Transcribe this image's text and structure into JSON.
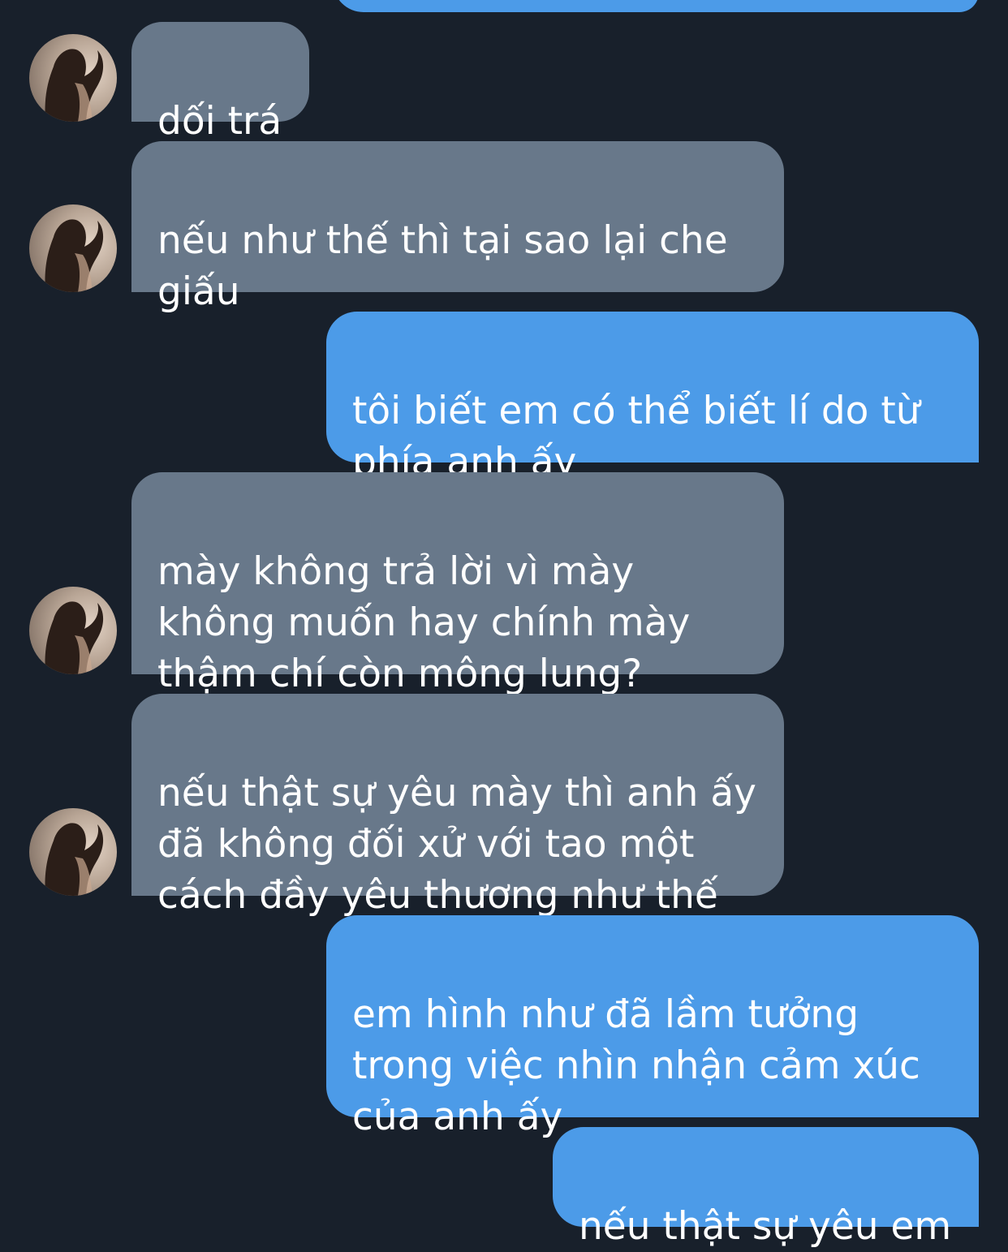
{
  "conversation": {
    "messages": [
      {
        "sender": "me",
        "text": ""
      },
      {
        "sender": "them",
        "text": "dối trá"
      },
      {
        "sender": "them",
        "text": "nếu như thế thì tại sao lại che\ngiấu"
      },
      {
        "sender": "me",
        "text": "tôi biết em có thể biết lí do từ\nphía anh ấy"
      },
      {
        "sender": "them",
        "text": "mày không trả lời vì mày\nkhông muốn hay chính mày\nthậm chí còn mông lung?"
      },
      {
        "sender": "them",
        "text": "nếu thật sự yêu mày thì anh ấy\nđã không đối xử với tao một\ncách đầy yêu thương như thế"
      },
      {
        "sender": "me",
        "text": "em hình như đã lầm tưởng\ntrong việc nhìn nhận cảm xúc\ncủa anh ấy"
      },
      {
        "sender": "me",
        "text": "nếu thật sự yêu em"
      }
    ]
  },
  "colors": {
    "background": "#18202b",
    "incoming_bubble": "#68788a",
    "outgoing_bubble": "#4c9be8"
  },
  "icons": {
    "avatar": "contact-avatar-photo"
  }
}
